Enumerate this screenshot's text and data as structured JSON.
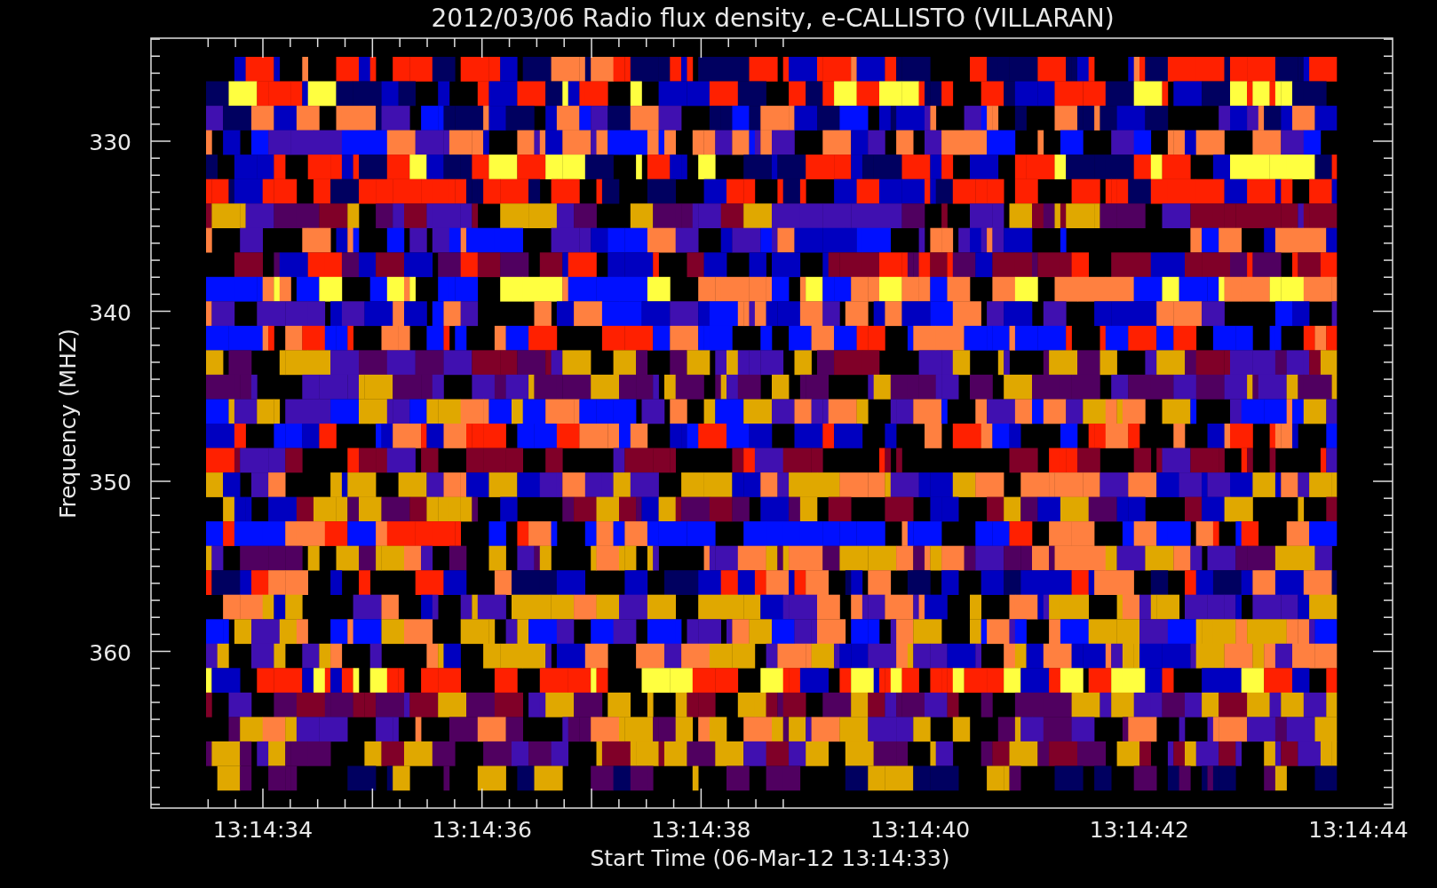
{
  "chart": {
    "title": "2012/03/06  Radio flux density, e-CALLISTO (VILLARAN)",
    "ylabel": "Frequency (MHZ)",
    "xlabel": "Start Time (06-Mar-12 13:14:33)",
    "yticks": [
      "330",
      "340",
      "350",
      "360"
    ],
    "xticks": [
      "13:14:34",
      "13:14:36",
      "13:14:38",
      "13:14:40",
      "13:14:42",
      "13:14:44"
    ]
  }
}
